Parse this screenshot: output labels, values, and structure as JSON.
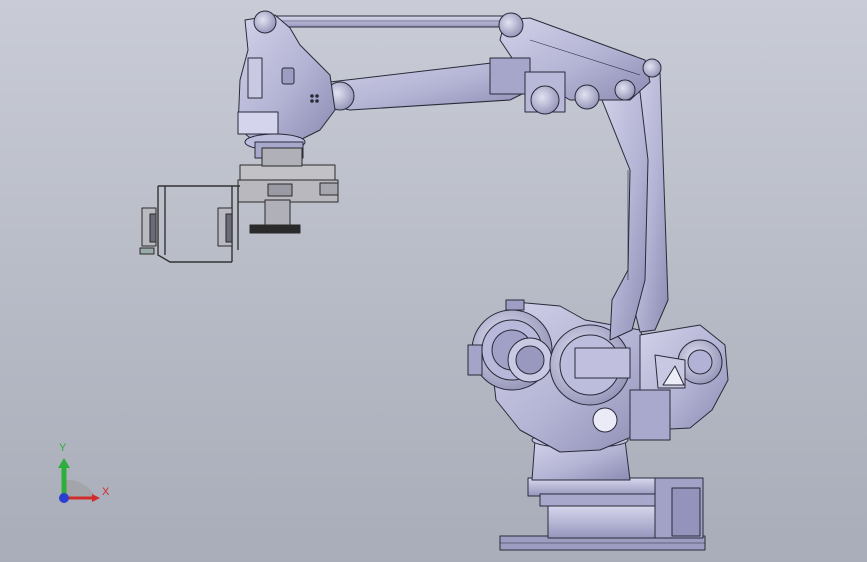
{
  "window": {
    "description_colors": {
      "background_top": "#c9ccd6",
      "background_bottom": "#a9adb9",
      "robot_fill": "#b4b4d6",
      "robot_shade": "#8f8fb8",
      "robot_light": "#d6d6ec",
      "edge": "#2a2a3a"
    }
  },
  "triad": {
    "y_label": "Y",
    "x_label": "X",
    "x_color": "#d22b2b",
    "y_color": "#2fae3a",
    "z_color": "#2a3fd0"
  },
  "icons": [
    "coordinate-triad-icon"
  ]
}
